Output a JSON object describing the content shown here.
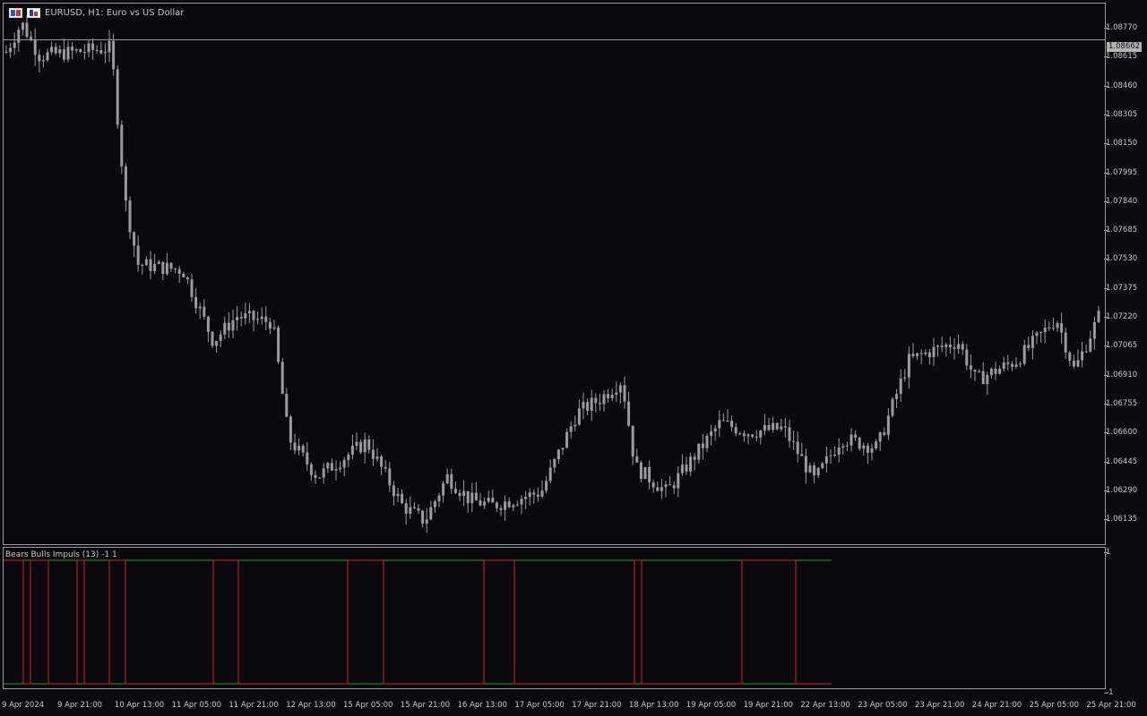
{
  "window": {
    "title": "EURUSD, H1:  Euro vs US Dollar",
    "icons": [
      "trade-panel-icon",
      "depth-of-market-icon"
    ]
  },
  "indicator": {
    "label": "Bears Bulls Impuls (13) -1 1"
  },
  "price_axis": {
    "ticks": [
      "1.08770",
      "1.08615",
      "1.08460",
      "1.08305",
      "1.08150",
      "1.07995",
      "1.07840",
      "1.07685",
      "1.07530",
      "1.07375",
      "1.07220",
      "1.07065",
      "1.06910",
      "1.06755",
      "1.06600",
      "1.06445",
      "1.06290",
      "1.06135"
    ],
    "current_price": "1.08662"
  },
  "indicator_axis": {
    "ticks": [
      "1",
      "-1"
    ]
  },
  "time_axis": {
    "ticks": [
      "9 Apr 2024",
      "9 Apr 21:00",
      "10 Apr 13:00",
      "11 Apr 05:00",
      "11 Apr 21:00",
      "12 Apr 13:00",
      "15 Apr 05:00",
      "15 Apr 21:00",
      "16 Apr 13:00",
      "17 Apr 05:00",
      "17 Apr 21:00",
      "18 Apr 13:00",
      "19 Apr 05:00",
      "19 Apr 21:00",
      "22 Apr 13:00",
      "23 Apr 05:00",
      "23 Apr 21:00",
      "24 Apr 21:00",
      "25 Apr 05:00",
      "25 Apr 21:00"
    ]
  },
  "colors": {
    "background": "#0a0a0e",
    "candle": "#9a9aa0",
    "bulls_line": "#1f9a1f",
    "bears_line": "#d42020",
    "grid": "#9a9a9a"
  },
  "chart_data": {
    "type": "candlestick",
    "symbol": "EURUSD",
    "timeframe": "H1",
    "ylim": [
      1.0605,
      1.0885
    ],
    "current_price": 1.08662,
    "anchor_closes": [
      {
        "t": "9 Apr 2024",
        "close": 1.086
      },
      {
        "t": "9 Apr 12:00",
        "close": 1.0875
      },
      {
        "t": "9 Apr 21:00",
        "close": 1.0858
      },
      {
        "t": "10 Apr 13:00",
        "close": 1.0862
      },
      {
        "t": "10 Apr 15:00",
        "close": 1.0782
      },
      {
        "t": "10 Apr 17:00",
        "close": 1.075
      },
      {
        "t": "11 Apr 05:00",
        "close": 1.0747
      },
      {
        "t": "11 Apr 14:00",
        "close": 1.071
      },
      {
        "t": "11 Apr 21:00",
        "close": 1.0723
      },
      {
        "t": "12 Apr 06:00",
        "close": 1.072
      },
      {
        "t": "12 Apr 13:00",
        "close": 1.066
      },
      {
        "t": "12 Apr 18:00",
        "close": 1.064
      },
      {
        "t": "15 Apr 05:00",
        "close": 1.0658
      },
      {
        "t": "15 Apr 14:00",
        "close": 1.0625
      },
      {
        "t": "15 Apr 21:00",
        "close": 1.0617
      },
      {
        "t": "16 Apr 06:00",
        "close": 1.064
      },
      {
        "t": "16 Apr 13:00",
        "close": 1.0628
      },
      {
        "t": "16 Apr 20:00",
        "close": 1.0625
      },
      {
        "t": "17 Apr 05:00",
        "close": 1.0632
      },
      {
        "t": "17 Apr 10:00",
        "close": 1.0673
      },
      {
        "t": "17 Apr 21:00",
        "close": 1.068
      },
      {
        "t": "18 Apr 02:00",
        "close": 1.069
      },
      {
        "t": "18 Apr 13:00",
        "close": 1.0645
      },
      {
        "t": "18 Apr 19:00",
        "close": 1.0632
      },
      {
        "t": "19 Apr 05:00",
        "close": 1.065
      },
      {
        "t": "19 Apr 09:00",
        "close": 1.0668
      },
      {
        "t": "19 Apr 21:00",
        "close": 1.0663
      },
      {
        "t": "22 Apr 06:00",
        "close": 1.0665
      },
      {
        "t": "22 Apr 13:00",
        "close": 1.0638
      },
      {
        "t": "22 Apr 21:00",
        "close": 1.066
      },
      {
        "t": "23 Apr 05:00",
        "close": 1.0655
      },
      {
        "t": "23 Apr 09:00",
        "close": 1.07
      },
      {
        "t": "23 Apr 16:00",
        "close": 1.0705
      },
      {
        "t": "23 Apr 21:00",
        "close": 1.071
      },
      {
        "t": "24 Apr 06:00",
        "close": 1.069
      },
      {
        "t": "24 Apr 21:00",
        "close": 1.07
      },
      {
        "t": "25 Apr 05:00",
        "close": 1.0722
      },
      {
        "t": "25 Apr 09:00",
        "close": 1.0695
      },
      {
        "t": "25 Apr 21:00",
        "close": 1.0728
      }
    ],
    "indicator": {
      "name": "Bears Bulls Impuls",
      "period": 13,
      "ylim": [
        -1,
        1
      ],
      "series": [
        {
          "name": "bulls",
          "color": "#1f9a1f"
        },
        {
          "name": "bears",
          "color": "#d42020"
        }
      ],
      "bulls_segments": [
        {
          "from": "9 Apr 2024",
          "to": "9 Apr 03:00",
          "value": -1
        },
        {
          "from": "9 Apr 04:00",
          "to": "9 Apr 07:00",
          "value": 1
        },
        {
          "from": "9 Apr 08:00",
          "to": "9 Apr 14:00",
          "value": -1
        },
        {
          "from": "9 Apr 15:00",
          "to": "9 Apr 19:00",
          "value": 1
        },
        {
          "from": "9 Apr 20:00",
          "to": "10 Apr 02:00",
          "value": -1
        },
        {
          "from": "10 Apr 03:00",
          "to": "10 Apr 08:00",
          "value": 1
        },
        {
          "from": "10 Apr 09:00",
          "to": "10 Apr 12:00",
          "value": -1
        },
        {
          "from": "10 Apr 13:00",
          "to": "11 Apr 14:00",
          "value": -1
        },
        {
          "from": "11 Apr 15:00",
          "to": "11 Apr 17:00",
          "value": 1
        },
        {
          "from": "11 Apr 18:00",
          "to": "12 Apr 06:00",
          "value": -1
        },
        {
          "from": "12 Apr 07:00",
          "to": "15 Apr 08:00",
          "value": -1
        },
        {
          "from": "15 Apr 09:00",
          "to": "16 Apr 02:00",
          "value": -1
        },
        {
          "from": "16 Apr 03:00",
          "to": "16 Apr 08:00",
          "value": 1
        },
        {
          "from": "16 Apr 09:00",
          "to": "16 Apr 16:00",
          "value": -1
        },
        {
          "from": "16 Apr 17:00",
          "to": "17 Apr 01:00",
          "value": 1
        },
        {
          "from": "17 Apr 02:00",
          "to": "18 Apr 04:00",
          "value": 1
        },
        {
          "from": "18 Apr 05:00",
          "to": "19 Apr 01:00",
          "value": -1
        },
        {
          "from": "19 Apr 02:00",
          "to": "19 Apr 12:00",
          "value": 1
        },
        {
          "from": "19 Apr 13:00",
          "to": "22 Apr 01:00",
          "value": 1
        },
        {
          "from": "22 Apr 02:00",
          "to": "22 Apr 09:00",
          "value": -1
        },
        {
          "from": "22 Apr 10:00",
          "to": "23 Apr 01:00",
          "value": 1
        },
        {
          "from": "23 Apr 02:00",
          "to": "24 Apr 05:00",
          "value": 1
        },
        {
          "from": "24 Apr 06:00",
          "to": "24 Apr 16:00",
          "value": -1
        },
        {
          "from": "24 Apr 17:00",
          "to": "25 Apr 05:00",
          "value": -1
        },
        {
          "from": "25 Apr 06:00",
          "to": "25 Apr 21:00",
          "value": 1
        }
      ],
      "note_bears_series": "bears line mirrors bulls line (value = -bulls)"
    }
  }
}
